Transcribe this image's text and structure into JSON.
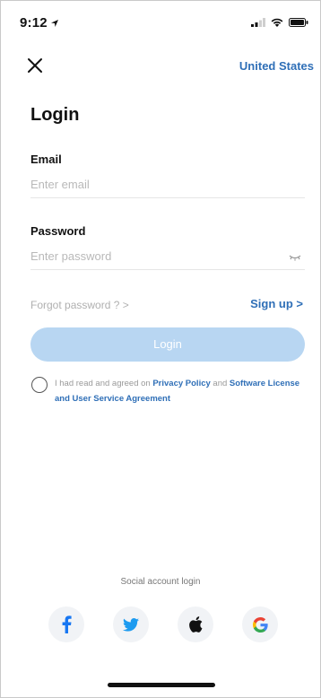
{
  "status_bar": {
    "time": "9:12",
    "icons": [
      "location-arrow-icon",
      "signal-icon",
      "wifi-icon",
      "battery-icon"
    ]
  },
  "header": {
    "close_icon": "close-icon",
    "region": "United States"
  },
  "title": "Login",
  "email": {
    "label": "Email",
    "placeholder": "Enter email",
    "value": ""
  },
  "password": {
    "label": "Password",
    "placeholder": "Enter password",
    "value": "",
    "toggle_icon": "eye-closed-icon"
  },
  "forgot_password": "Forgot password ? >",
  "sign_up": "Sign up >",
  "login_button": "Login",
  "agreement": {
    "checked": false,
    "prefix": "I had read and agreed on",
    "privacy_link": "Privacy Policy",
    "connector": "and",
    "license_link": "Software License and User Service Agreement"
  },
  "social": {
    "caption": "Social account login",
    "providers": [
      "facebook-icon",
      "twitter-icon",
      "apple-icon",
      "google-icon"
    ]
  },
  "colors": {
    "accent": "#2f6fb7",
    "login_disabled": "#b8d6f2",
    "facebook": "#1877f2",
    "twitter": "#1d9bf0",
    "google": "#4285f4"
  }
}
